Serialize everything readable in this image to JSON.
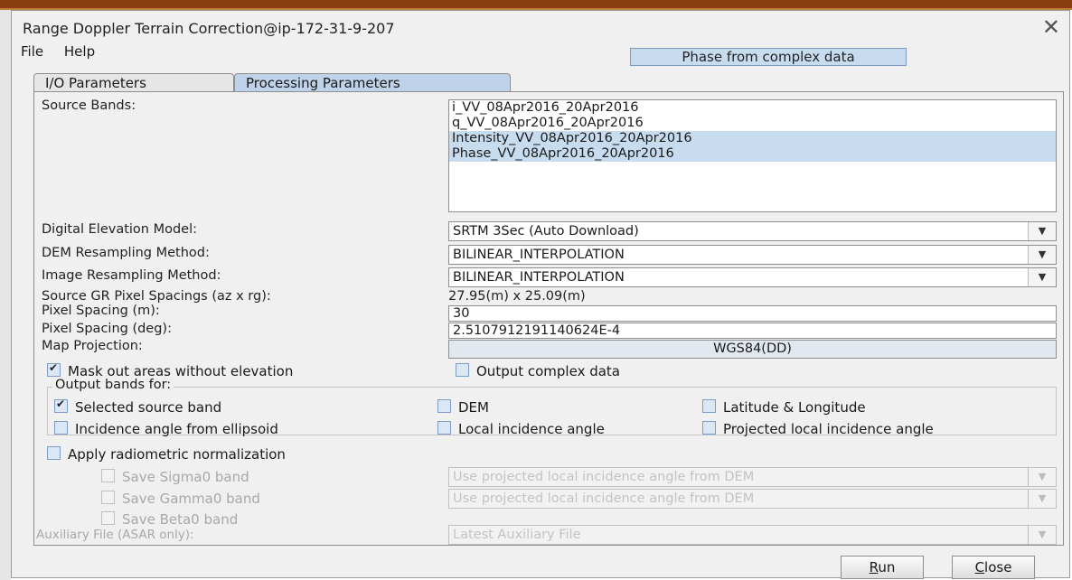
{
  "window": {
    "title": "Range Doppler Terrain Correction@ip-172-31-9-207",
    "close_icon": "✕"
  },
  "menu": {
    "file": "File",
    "help": "Help"
  },
  "status_badge": "Phase from complex data",
  "tabs": [
    {
      "label": "I/O Parameters",
      "active": false
    },
    {
      "label": "Processing Parameters",
      "active": true
    }
  ],
  "source_bands": {
    "label": "Source Bands:",
    "items": [
      {
        "name": "i_VV_08Apr2016_20Apr2016",
        "selected": false
      },
      {
        "name": "q_VV_08Apr2016_20Apr2016",
        "selected": false
      },
      {
        "name": "Intensity_VV_08Apr2016_20Apr2016",
        "selected": true
      },
      {
        "name": "Phase_VV_08Apr2016_20Apr2016",
        "selected": true
      }
    ]
  },
  "dem": {
    "label": "Digital Elevation Model:",
    "value": "SRTM 3Sec (Auto Download)"
  },
  "dem_resampling": {
    "label": "DEM Resampling Method:",
    "value": "BILINEAR_INTERPOLATION"
  },
  "image_resampling": {
    "label": "Image Resampling Method:",
    "value": "BILINEAR_INTERPOLATION"
  },
  "source_spacing": {
    "label": "Source GR Pixel Spacings (az x rg):",
    "value": "27.95(m) x 25.09(m)"
  },
  "pixel_spacing_m": {
    "label": "Pixel Spacing (m):",
    "value": "30"
  },
  "pixel_spacing_deg": {
    "label": "Pixel Spacing (deg):",
    "value": "2.5107912191140624E-4"
  },
  "map_projection": {
    "label": "Map Projection:",
    "value": "WGS84(DD)"
  },
  "options": {
    "mask_out": {
      "label": "Mask out areas without elevation",
      "checked": true
    },
    "output_complex": {
      "label": "Output complex data",
      "checked": false
    }
  },
  "output_bands": {
    "title": "Output bands for:",
    "selected_source": {
      "label": "Selected source band",
      "checked": true
    },
    "dem": {
      "label": "DEM",
      "checked": false
    },
    "lat_long": {
      "label": "Latitude & Longitude",
      "checked": false
    },
    "incidence_ellipsoid": {
      "label": "Incidence angle from ellipsoid",
      "checked": false
    },
    "local_incidence": {
      "label": "Local incidence angle",
      "checked": false
    },
    "projected_local_incidence": {
      "label": "Projected local incidence angle",
      "checked": false
    }
  },
  "radiometric": {
    "apply": {
      "label": "Apply radiometric normalization",
      "checked": false
    },
    "sigma0": {
      "label": "Save Sigma0 band",
      "checked": false,
      "combo": "Use projected local incidence angle from DEM"
    },
    "gamma0": {
      "label": "Save Gamma0 band",
      "checked": false,
      "combo": "Use projected local incidence angle from DEM"
    },
    "beta0": {
      "label": "Save Beta0 band",
      "checked": false
    },
    "aux_file": {
      "label": "Auxiliary File (ASAR only):",
      "value": "Latest Auxiliary File"
    }
  },
  "buttons": {
    "run_mnemonic": "R",
    "run_rest": "un",
    "close_mnemonic": "C",
    "close_rest": "lose"
  },
  "icons": {
    "combo_arrow": "▼"
  },
  "colors": {
    "selection": "#c8dcf0",
    "active_tab": "#bed3ea",
    "top_border": "#8a3d0f"
  }
}
